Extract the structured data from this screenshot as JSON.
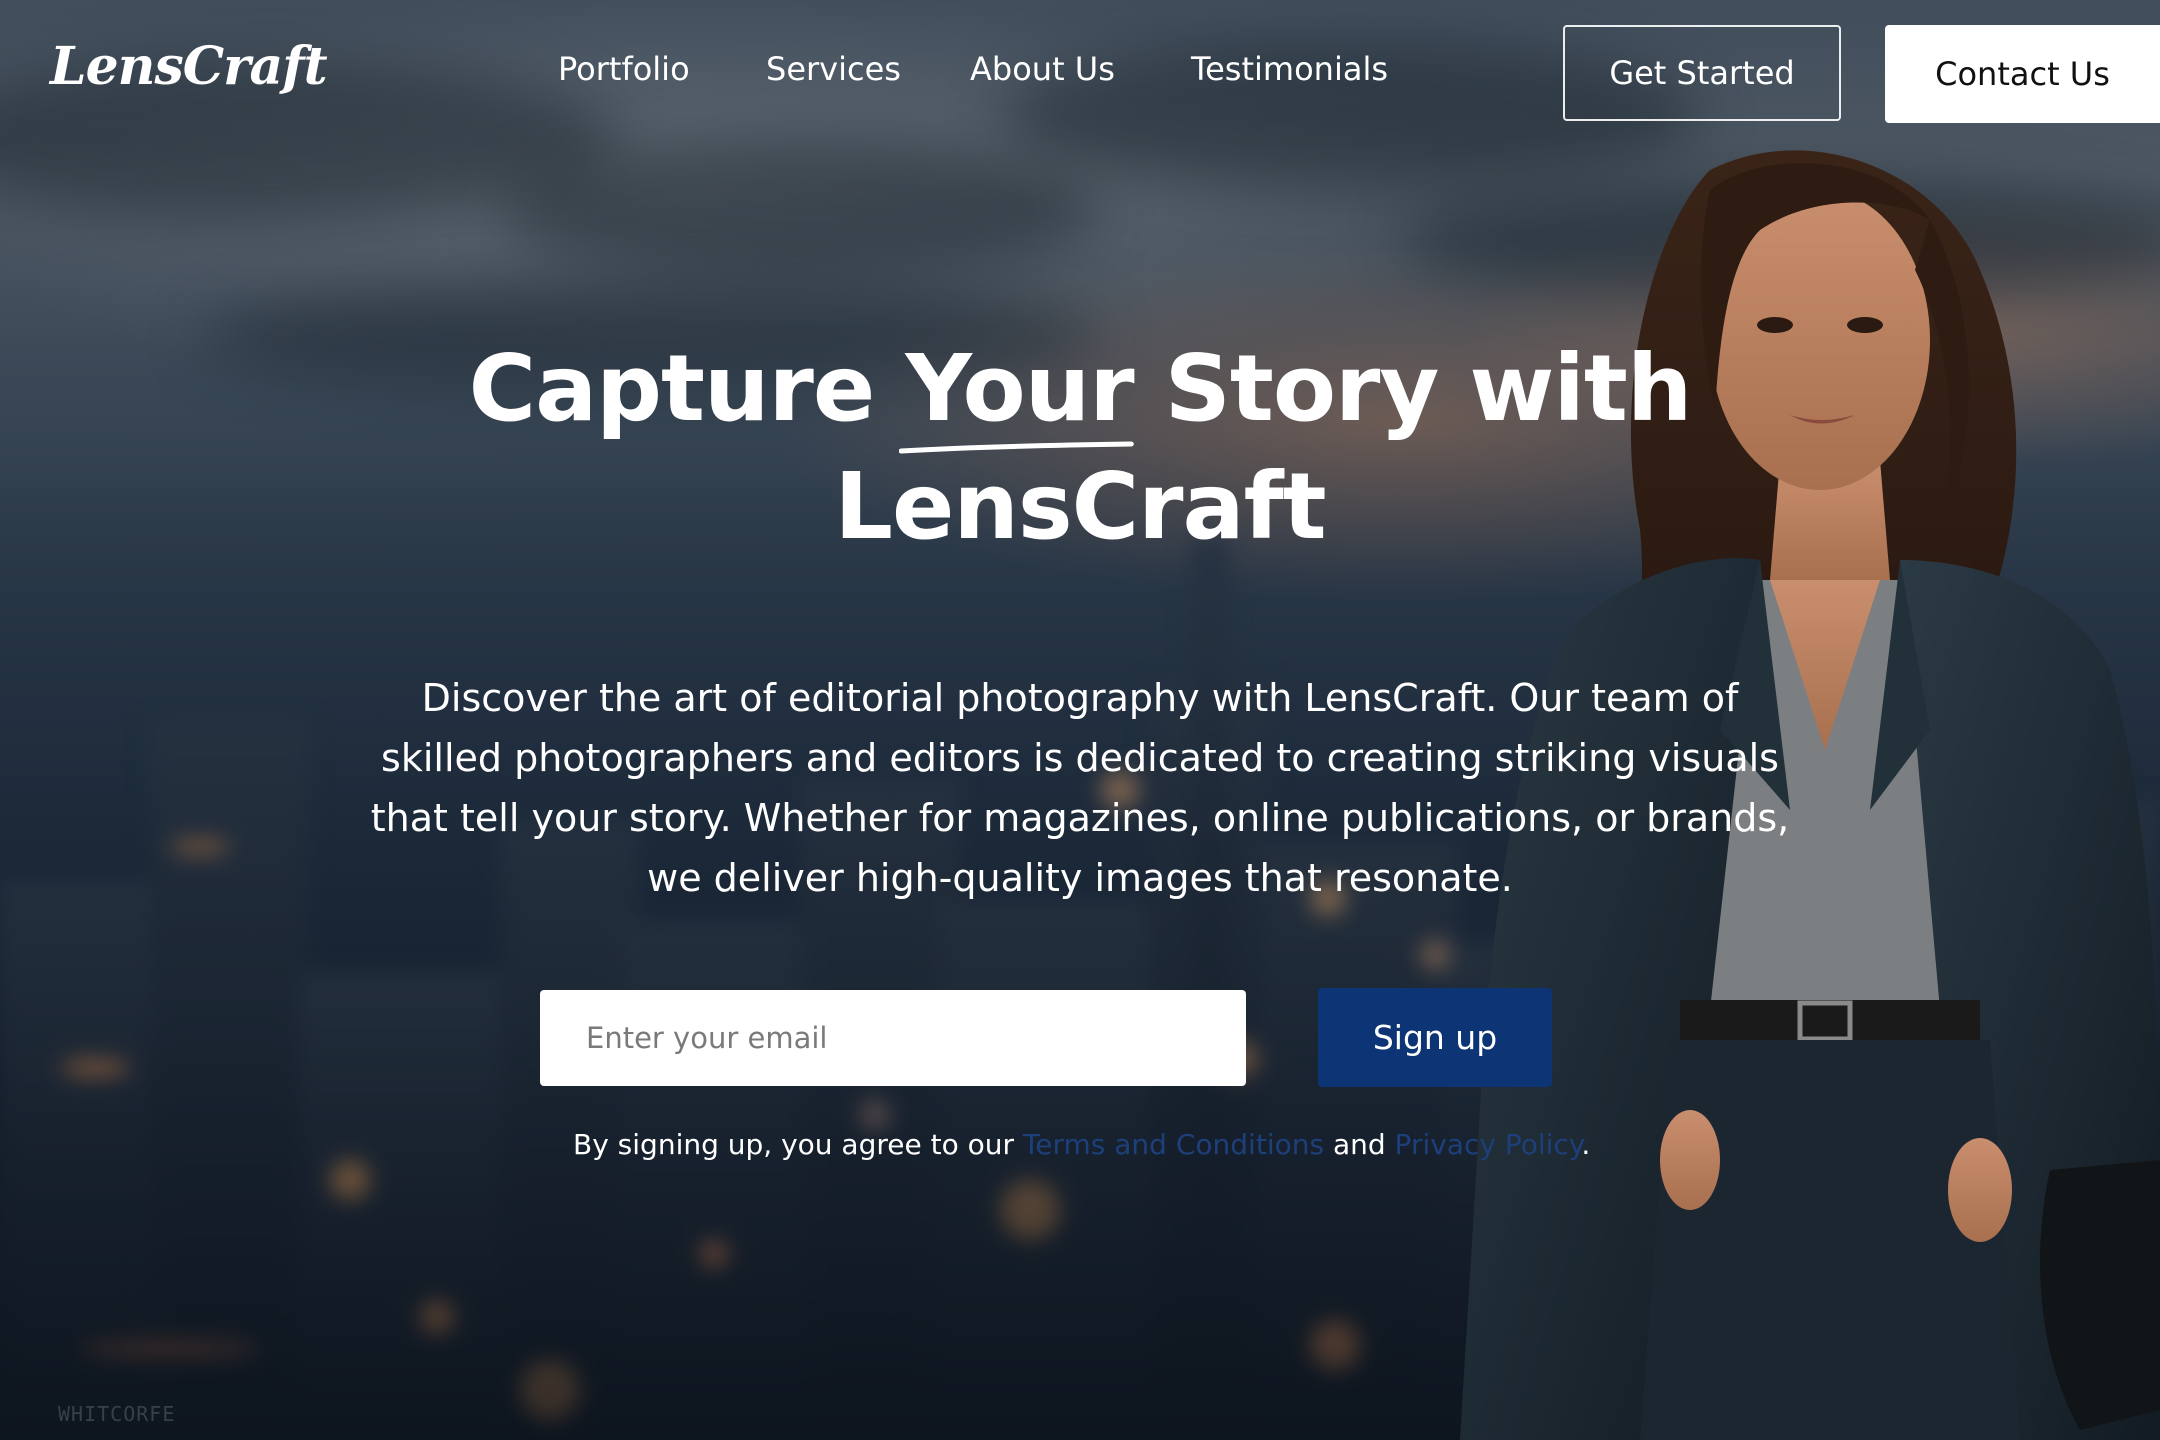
{
  "brand": {
    "logo_text": "LensCraft"
  },
  "nav": {
    "links": [
      "Portfolio",
      "Services",
      "About Us",
      "Testimonials"
    ],
    "get_started_label": "Get Started",
    "contact_label": "Contact Us"
  },
  "hero": {
    "title_before": "Capture ",
    "title_emphasis": "Your",
    "title_after": " Story with LensCraft",
    "description": "Discover the art of editorial photography with LensCraft. Our team of skilled photographers and editors is dedicated to creating striking visuals that tell your story. Whether for magazines, online publications, or brands, we deliver high-quality images that resonate."
  },
  "signup": {
    "email_placeholder": "Enter your email",
    "button_label": "Sign up",
    "legal_prefix": "By signing up, you agree to our ",
    "terms_link": "Terms and Conditions",
    "legal_middle": " and ",
    "privacy_link": "Privacy Policy",
    "legal_suffix": "."
  },
  "watermark": {
    "text": "WHITCORFE"
  },
  "colors": {
    "primary_button": "#0d3474",
    "link": "#1d3f7a",
    "text": "#ffffff"
  }
}
